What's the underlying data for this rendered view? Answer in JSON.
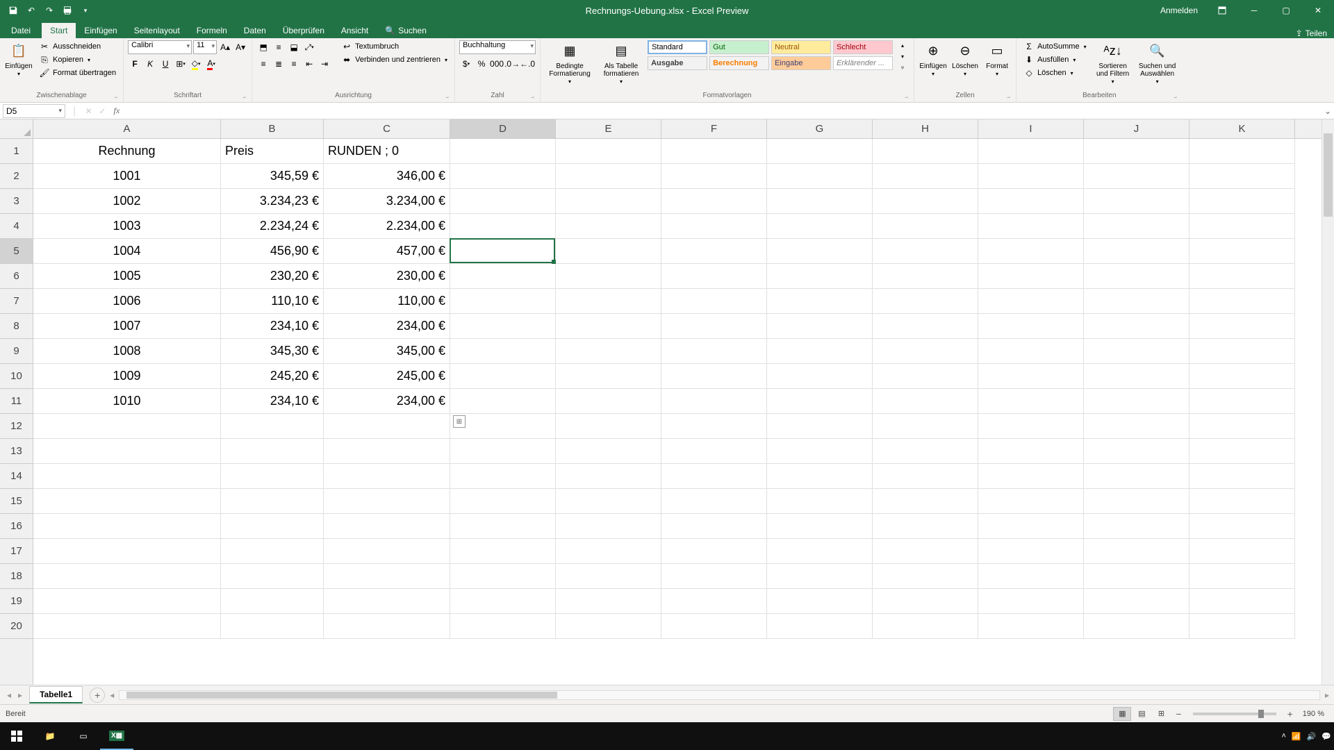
{
  "title": "Rechnungs-Uebung.xlsx - Excel Preview",
  "signin": "Anmelden",
  "tabs": {
    "file": "Datei",
    "list": [
      "Start",
      "Einfügen",
      "Seitenlayout",
      "Formeln",
      "Daten",
      "Überprüfen",
      "Ansicht"
    ],
    "active": "Start",
    "search_icon": "🔍",
    "search": "Suchen",
    "share": "Teilen"
  },
  "ribbon": {
    "clipboard": {
      "paste": "Einfügen",
      "cut": "Ausschneiden",
      "copy": "Kopieren",
      "fmt": "Format übertragen",
      "label": "Zwischenablage"
    },
    "font": {
      "name": "Calibri",
      "size": "11",
      "label": "Schriftart"
    },
    "align": {
      "wrap": "Textumbruch",
      "merge": "Verbinden und zentrieren",
      "label": "Ausrichtung"
    },
    "number": {
      "format": "Buchhaltung",
      "label": "Zahl"
    },
    "styles": {
      "cond": "Bedingte Formatierung",
      "table": "Als Tabelle formatieren",
      "standard": "Standard",
      "gut": "Gut",
      "neutral": "Neutral",
      "schlecht": "Schlecht",
      "ausgabe": "Ausgabe",
      "berechnung": "Berechnung",
      "eingabe": "Eingabe",
      "erklar": "Erklärender ...",
      "label": "Formatvorlagen"
    },
    "cells": {
      "insert": "Einfügen",
      "delete": "Löschen",
      "format": "Format",
      "label": "Zellen"
    },
    "editing": {
      "sum": "AutoSumme",
      "fill": "Ausfüllen",
      "clear": "Löschen",
      "sort": "Sortieren und Filtern",
      "find": "Suchen und Auswählen",
      "label": "Bearbeiten"
    }
  },
  "namebox": "D5",
  "columns": [
    "A",
    "B",
    "C",
    "D",
    "E",
    "F",
    "G",
    "H",
    "I",
    "J",
    "K"
  ],
  "selected_col": "D",
  "selected_row": 5,
  "chart_data": {
    "type": "table",
    "headers": [
      "Rechnung",
      "Preis",
      "RUNDEN ; 0"
    ],
    "rows": [
      [
        "1001",
        "345,59 €",
        "346,00 €"
      ],
      [
        "1002",
        "3.234,23 €",
        "3.234,00 €"
      ],
      [
        "1003",
        "2.234,24 €",
        "2.234,00 €"
      ],
      [
        "1004",
        "456,90 €",
        "457,00 €"
      ],
      [
        "1005",
        "230,20 €",
        "230,00 €"
      ],
      [
        "1006",
        "110,10 €",
        "110,00 €"
      ],
      [
        "1007",
        "234,10 €",
        "234,00 €"
      ],
      [
        "1008",
        "345,30 €",
        "345,00 €"
      ],
      [
        "1009",
        "245,20 €",
        "245,00 €"
      ],
      [
        "1010",
        "234,10 €",
        "234,00 €"
      ]
    ]
  },
  "sheet_tab": "Tabelle1",
  "status": "Bereit",
  "zoom": "190 %"
}
